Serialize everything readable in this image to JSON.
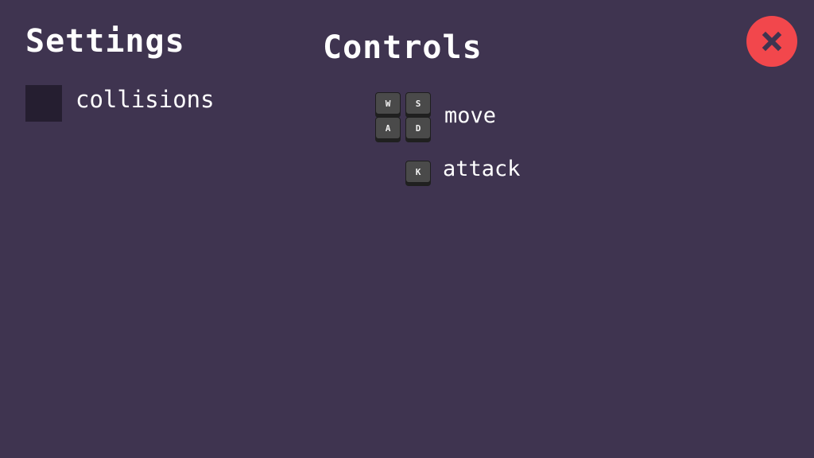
{
  "settings": {
    "title": "Settings",
    "collisions_label": "collisions",
    "collisions_checked": false
  },
  "controls": {
    "title": "Controls",
    "move": {
      "keys": [
        "W",
        "S",
        "A",
        "D"
      ],
      "label": "move"
    },
    "attack": {
      "keys": [
        "K"
      ],
      "label": "attack"
    }
  },
  "close_button": {
    "icon": "close-icon"
  },
  "colors": {
    "background": "#3f3450",
    "checkbox": "#251e30",
    "close_button": "#f2474c",
    "close_icon": "#3f3450",
    "key_face": "#4a4a4a",
    "text": "#ffffff"
  }
}
